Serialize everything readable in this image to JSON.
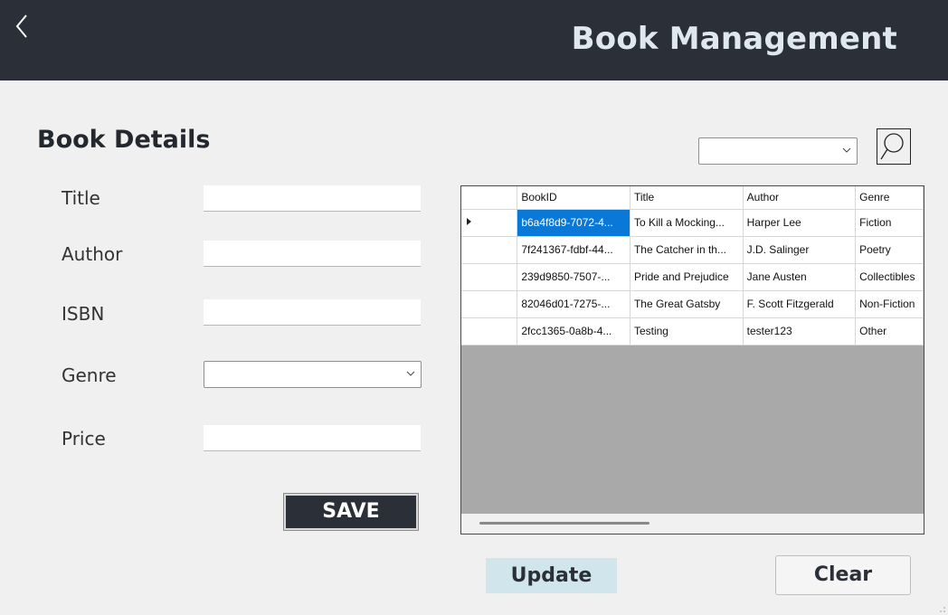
{
  "header": {
    "title": "Book Management",
    "back_icon": "chevron-left-icon"
  },
  "form": {
    "section_title": "Book Details",
    "fields": {
      "title": {
        "label": "Title",
        "value": ""
      },
      "author": {
        "label": "Author",
        "value": ""
      },
      "isbn": {
        "label": "ISBN",
        "value": ""
      },
      "genre": {
        "label": "Genre",
        "value": ""
      },
      "price": {
        "label": "Price",
        "value": ""
      }
    },
    "save_label": "SAVE"
  },
  "search": {
    "combo_value": "",
    "icon": "search-icon"
  },
  "grid": {
    "columns": [
      "BookID",
      "Title",
      "Author",
      "Genre"
    ],
    "rows": [
      [
        "b6a4f8d9-7072-4...",
        "To Kill a Mocking...",
        "Harper Lee",
        "Fiction"
      ],
      [
        "7f241367-fdbf-44...",
        "The Catcher in th...",
        "J.D. Salinger",
        "Poetry"
      ],
      [
        "239d9850-7507-...",
        "Pride and Prejudice",
        "Jane Austen",
        "Collectibles"
      ],
      [
        "82046d01-7275-...",
        "The Great Gatsby",
        "F. Scott Fitzgerald",
        "Non-Fiction"
      ],
      [
        "2fcc1365-0a8b-4...",
        "Testing",
        "tester123",
        "Other"
      ]
    ],
    "selected_row": 0
  },
  "actions": {
    "update_label": "Update",
    "clear_label": "Clear"
  },
  "colors": {
    "header_bg": "#2b3038",
    "selection": "#0a78d7",
    "update_bg": "#d0e6ec"
  }
}
